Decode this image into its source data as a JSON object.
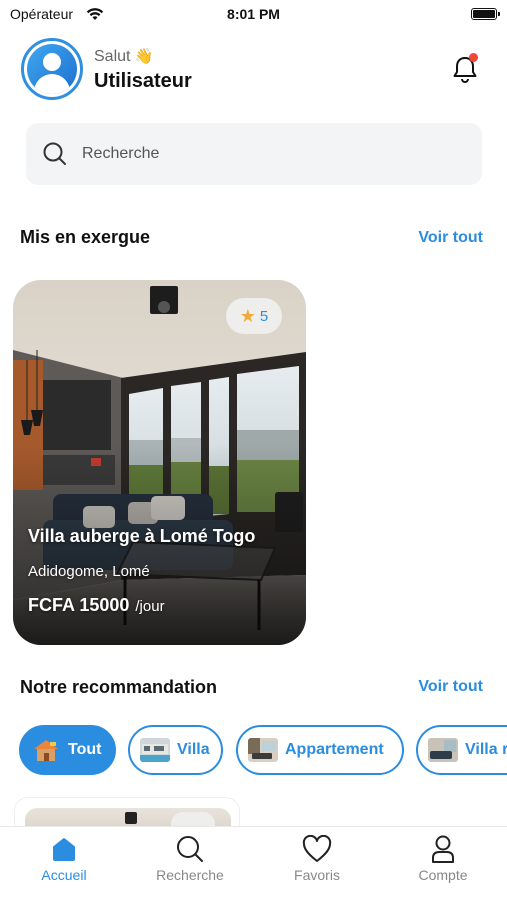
{
  "status_bar": {
    "carrier": "Opérateur",
    "time": "8:01 PM"
  },
  "header": {
    "greeting": "Salut",
    "greeting_emoji": "👋",
    "username": "Utilisateur"
  },
  "search": {
    "placeholder": "Recherche"
  },
  "featured": {
    "title": "Mis en exergue",
    "see_all": "Voir tout",
    "card": {
      "rating": "5",
      "title": "Villa auberge à Lomé Togo",
      "location": "Adidogome, Lomé",
      "price": "FCFA 15000",
      "period": "/jour"
    }
  },
  "recommendation": {
    "title": "Notre recommandation",
    "see_all": "Voir tout",
    "chips": [
      {
        "label": "Tout",
        "active": true
      },
      {
        "label": "Villa",
        "active": false
      },
      {
        "label": "Appartement",
        "active": false
      },
      {
        "label": "Villa r",
        "active": false
      }
    ]
  },
  "tabs": [
    {
      "label": "Accueil",
      "icon": "home-icon",
      "active": true
    },
    {
      "label": "Recherche",
      "icon": "search-icon",
      "active": false
    },
    {
      "label": "Favoris",
      "icon": "heart-icon",
      "active": false
    },
    {
      "label": "Compte",
      "icon": "user-icon",
      "active": false
    }
  ],
  "colors": {
    "accent": "#2b8de0",
    "notification": "#f0463c",
    "star": "#f3a83a"
  }
}
